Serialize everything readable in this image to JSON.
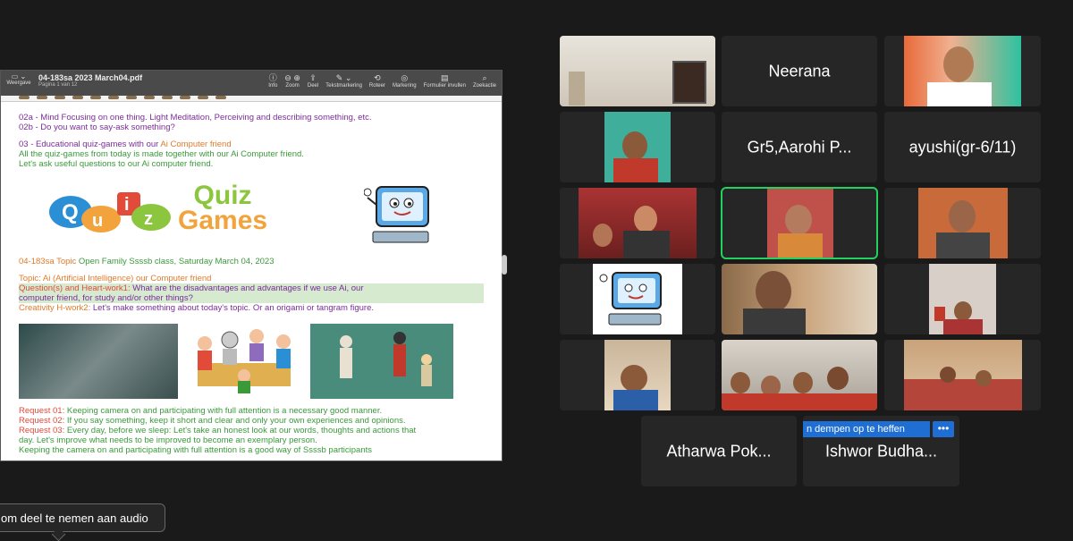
{
  "preview": {
    "sidebar_label": "Weergave",
    "title": "04-183sa 2023 March04.pdf",
    "page_info": "Pagina 1 van 12",
    "tools": [
      {
        "icon": "info-icon",
        "label": "Info"
      },
      {
        "icon": "zoom-out-icon",
        "label": "Zoom"
      },
      {
        "icon": "share-icon",
        "label": "Deel"
      },
      {
        "icon": "markup-icon",
        "label": "Tekstmarkering"
      },
      {
        "icon": "rotate-icon",
        "label": "Roteer"
      },
      {
        "icon": "annotate-icon",
        "label": "Markering"
      },
      {
        "icon": "form-icon",
        "label": "Formulier invullen"
      },
      {
        "icon": "search-icon",
        "label": "Zoekactie"
      }
    ]
  },
  "document": {
    "line1": "02a - Mind Focusing on one thing. Light Meditation, Perceiving and describing something, etc.",
    "line2": "02b - Do you want to say-ask something?",
    "line3a": "03 - Educational quiz-games with our ",
    "line3b": "Ai Computer friend",
    "line4": "All the quiz-games from today is made together with our Ai Computer friend.",
    "line5": "Let's ask useful questions to our Ai computer friend.",
    "quiz_logo_q": "Q",
    "quiz_logo_rest": "uiz",
    "quiz_logo_i": "i",
    "quiz_games_1": "Quiz",
    "quiz_games_2": "Games",
    "topic_line_a": "04-183sa Topic ",
    "topic_line_b": "Open Family Ssssb class, Saturday March 04, 2023",
    "topic2": "Topic: Ai (Artificial Intelligence) our Computer friend",
    "q_label": "Question(s) and Heart-work1:",
    "q_text1": " What are the disadvantages and advantages if we use Ai, our",
    "q_text2": "computer friend, for study and/or other things?",
    "c_label": "Creativity H-work2:",
    "c_text": " Let's make something about today's topic. Or an origami or tangram figure.",
    "req1_label": "Request 01:",
    "req1": " Keeping camera on and participating with full attention is a necessary good manner.",
    "req2_label": "Request 02:",
    "req2": " If you say something, keep it short and clear and only your own experiences and opinions.",
    "req3_label": "Request 03:",
    "req3a": " Every day, before we sleep: Let's take an honest look at our words, thoughts and actions that",
    "req3b": "day. Let's improve what needs to be improved to become an exemplary person.",
    "req4": "Keeping the camera on and participating with full attention is a good way of Ssssb participants"
  },
  "participants": {
    "neerana": "Neerana",
    "aarohi": "Gr5,Aarohi P...",
    "ayushi": "ayushi(gr-6/11)",
    "atharwa": "Atharwa Pok...",
    "ishwor": "Ishwor Budha..."
  },
  "tooltip_unmute": "n dempen op te heffen",
  "more_label": "•••",
  "audio_popup": "om deel te nemen aan audio",
  "colors": {
    "accent_blue": "#1f6ed4",
    "active_speaker": "#23d160",
    "tile_bg": "#262626"
  }
}
